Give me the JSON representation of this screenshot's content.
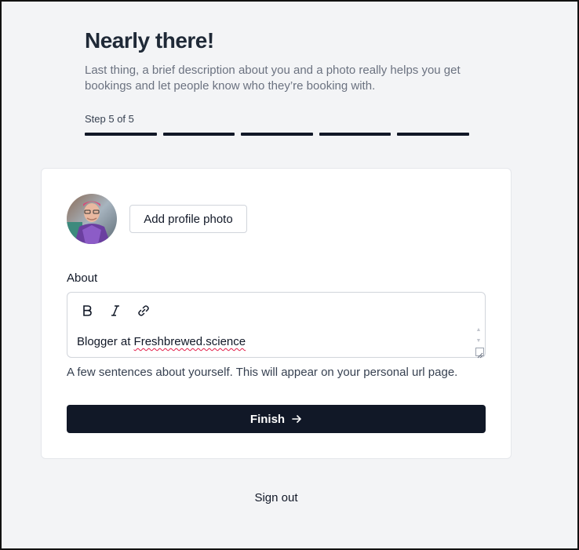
{
  "header": {
    "title": "Nearly there!",
    "subtitle": "Last thing, a brief description about you and a photo really helps you get bookings and let people know who they’re booking with.",
    "step_label": "Step 5 of 5",
    "steps_total": 5,
    "steps_completed": 5
  },
  "profile": {
    "avatar_icon": "user-photo",
    "add_photo_label": "Add profile photo"
  },
  "about": {
    "label": "About",
    "toolbar": [
      "bold-icon",
      "italic-icon",
      "link-icon"
    ],
    "text_prefix": "Blogger at ",
    "text_link": "Freshbrewed.science",
    "helper": "A few sentences about yourself. This will appear on your personal url page."
  },
  "actions": {
    "finish_label": "Finish",
    "signout_label": "Sign out"
  },
  "colors": {
    "background": "#f3f4f6",
    "primary": "#111827",
    "muted_text": "#6b7280"
  }
}
